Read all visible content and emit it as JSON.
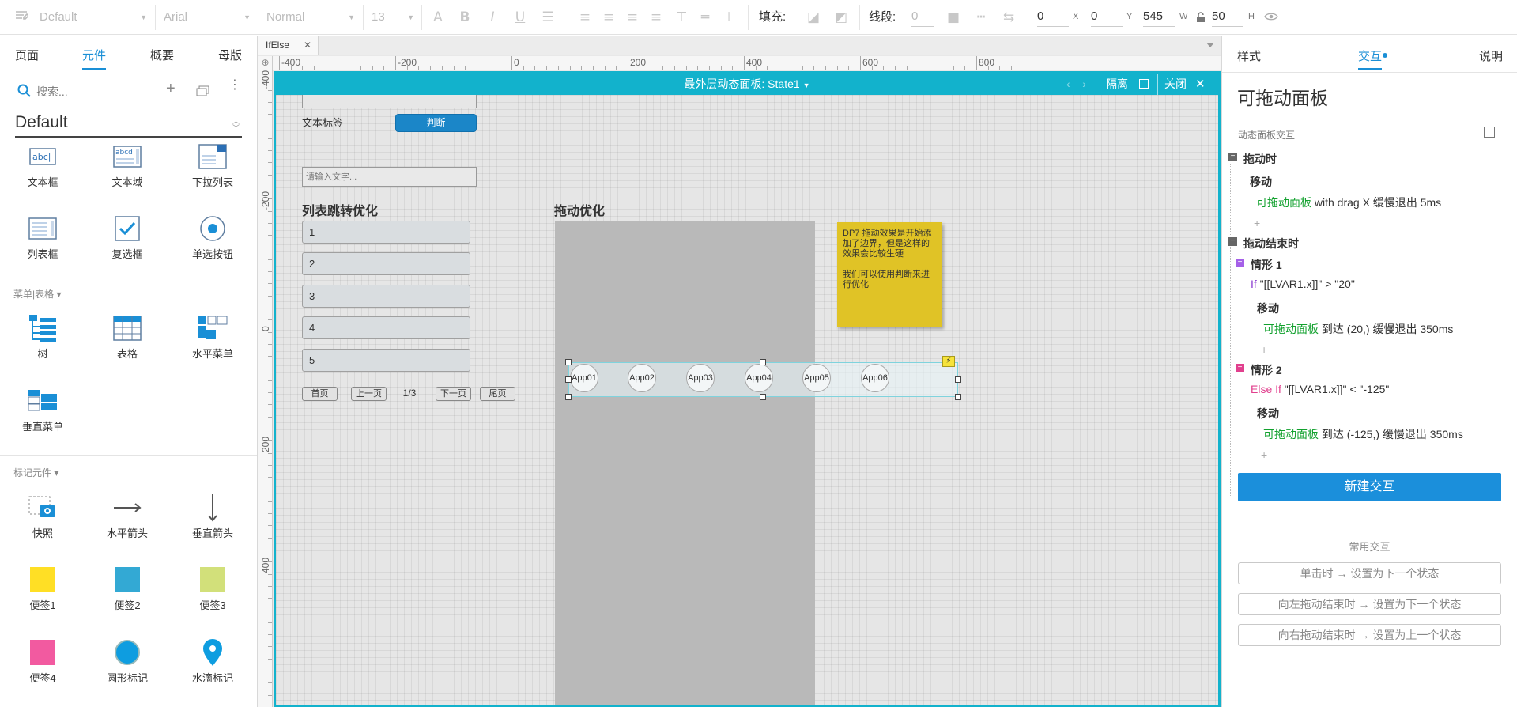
{
  "toolbar": {
    "style_name": "Default",
    "font_family": "Arial",
    "font_weight": "Normal",
    "font_size": "13",
    "fill_label": "填充:",
    "stroke_label": "线段:",
    "stroke_value": "0",
    "x_value": "0",
    "x_unit": "X",
    "y_value": "0",
    "y_unit": "Y",
    "w_value": "545",
    "w_unit": "W",
    "h_value": "50",
    "h_unit": "H"
  },
  "left_panel": {
    "tabs": [
      "页面",
      "元件",
      "概要",
      "母版"
    ],
    "active_tab": "元件",
    "search_placeholder": "搜索...",
    "library_name": "Default",
    "basic_items": [
      "文本框",
      "文本域",
      "下拉列表",
      "列表框",
      "复选框",
      "单选按钮"
    ],
    "menu_section": "菜单|表格 ▾",
    "menu_items": [
      "树",
      "表格",
      "水平菜单",
      "垂直菜单"
    ],
    "markup_section": "标记元件 ▾",
    "markup_items": [
      "快照",
      "水平箭头",
      "垂直箭头",
      "便签1",
      "便签2",
      "便签3",
      "便签4",
      "圆形标记",
      "水滴标记"
    ],
    "note_colors": [
      "#ffdf25",
      "#33a9d4",
      "#d2e07a",
      "#f25aa0",
      "#0e9de0",
      "#0e9de0"
    ]
  },
  "canvas": {
    "doc_tab": "IfElse",
    "ruler_x": [
      "-400",
      "-200",
      "0",
      "200",
      "400",
      "600",
      "800"
    ],
    "ruler_y": [
      "-400",
      "-200",
      "0",
      "200",
      "400"
    ],
    "panel_title": "最外层动态面板: State1",
    "isolate_label": "隔离",
    "close_label": "关闭",
    "widgets": {
      "text_label": "文本标签",
      "judge_button": "判断",
      "text_input_placeholder": "请输入文字...",
      "list_heading": "列表跳转优化",
      "list_items": [
        "1",
        "2",
        "3",
        "4",
        "5"
      ],
      "pager": {
        "first": "首页",
        "prev": "上一页",
        "page": "1/3",
        "next": "下一页",
        "last": "尾页"
      },
      "drag_heading": "拖动优化",
      "sticky_note_line1": "DP7 拖动效果是开始添加了边界，但是这样的效果会比较生硬",
      "sticky_note_line2": "我们可以使用判断来进行优化",
      "apps": [
        "App01",
        "App02",
        "App03",
        "App04",
        "App05",
        "App06"
      ]
    }
  },
  "right_panel": {
    "tabs": [
      "样式",
      "交互",
      "说明"
    ],
    "active_tab": "交互",
    "title": "可拖动面板",
    "subtitle": "动态面板交互",
    "events": {
      "drag_event": "拖动时",
      "drag_action": "移动",
      "drag_target": "可拖动面板",
      "drag_detail": " with drag X 缓慢退出 5ms",
      "drag_end_event": "拖动结束时",
      "case1": "情形 1",
      "case1_keyword": "If",
      "case1_cond": " \"[[LVAR1.x]]\" > \"20\"",
      "case1_action": "移动",
      "case1_target": "可拖动面板",
      "case1_detail": " 到达 (20,) 缓慢退出 350ms",
      "case2": "情形 2",
      "case2_keyword": "Else If",
      "case2_cond": " \"[[LVAR1.x]]\" < \"-125\"",
      "case2_action": "移动",
      "case2_target": "可拖动面板",
      "case2_detail": " 到达 (-125,) 缓慢退出 350ms"
    },
    "new_interaction": "新建交互",
    "common_heading": "常用交互",
    "common_buttons": [
      "单击时 → 设置为下一个状态",
      "向左拖动结束时 → 设置为下一个状态",
      "向右拖动结束时 → 设置为上一个状态"
    ]
  }
}
